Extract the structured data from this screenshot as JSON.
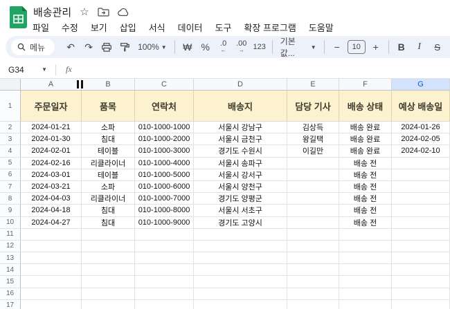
{
  "titlebar": {
    "title": "배송관리",
    "menus": [
      "파일",
      "수정",
      "보기",
      "삽입",
      "서식",
      "데이터",
      "도구",
      "확장 프로그램",
      "도움말"
    ]
  },
  "toolbar": {
    "search_label": "메뉴",
    "zoom_value": "100%",
    "currency_label": "₩",
    "percent_label": "%",
    "decrease_decimal_label": ".0",
    "increase_decimal_label": ".00",
    "number_format_label": "123",
    "font_name": "기본값...",
    "font_size": "10",
    "minus_label": "−",
    "plus_label": "+",
    "bold_label": "B",
    "italic_label": "I",
    "strikethrough_label": "S"
  },
  "formula_bar": {
    "cell_ref": "G34",
    "fx_label": "fx"
  },
  "sheet": {
    "selected_column": "G",
    "column_letters": [
      "A",
      "B",
      "C",
      "D",
      "E",
      "F",
      "G"
    ],
    "header_row": [
      "주문일자",
      "품목",
      "연락처",
      "배송지",
      "담당 기사",
      "배송 상태",
      "예상 배송일"
    ],
    "rows": [
      [
        "2024-01-21",
        "소파",
        "010-1000-1000",
        "서울시 강남구",
        "김상득",
        "배송 완료",
        "2024-01-26"
      ],
      [
        "2024-01-30",
        "침대",
        "010-1000-2000",
        "서울시 금천구",
        "왕길택",
        "배송 완료",
        "2024-02-05"
      ],
      [
        "2024-02-01",
        "테이블",
        "010-1000-3000",
        "경기도 수원시",
        "이길만",
        "배송 완료",
        "2024-02-10"
      ],
      [
        "2024-02-16",
        "리클라이너",
        "010-1000-4000",
        "서울시 송파구",
        "",
        "배송 전",
        ""
      ],
      [
        "2024-03-01",
        "테이블",
        "010-1000-5000",
        "서울시 강서구",
        "",
        "배송 전",
        ""
      ],
      [
        "2024-03-21",
        "소파",
        "010-1000-6000",
        "서울시 양천구",
        "",
        "배송 전",
        ""
      ],
      [
        "2024-04-03",
        "리클라이너",
        "010-1000-7000",
        "경기도 양평군",
        "",
        "배송 전",
        ""
      ],
      [
        "2024-04-18",
        "침대",
        "010-1000-8000",
        "서울시 서초구",
        "",
        "배송 전",
        ""
      ],
      [
        "2024-04-27",
        "침대",
        "010-1000-9000",
        "경기도 고양시",
        "",
        "배송 전",
        ""
      ]
    ],
    "total_rows": 17
  },
  "colors": {
    "brand_green": "#21a464",
    "toolbar_bg": "#edf2fa",
    "header_row_fill": "#fdf2cf",
    "selected_column_fill": "#d3e3fd",
    "selected_column_text": "#0b57d0"
  }
}
